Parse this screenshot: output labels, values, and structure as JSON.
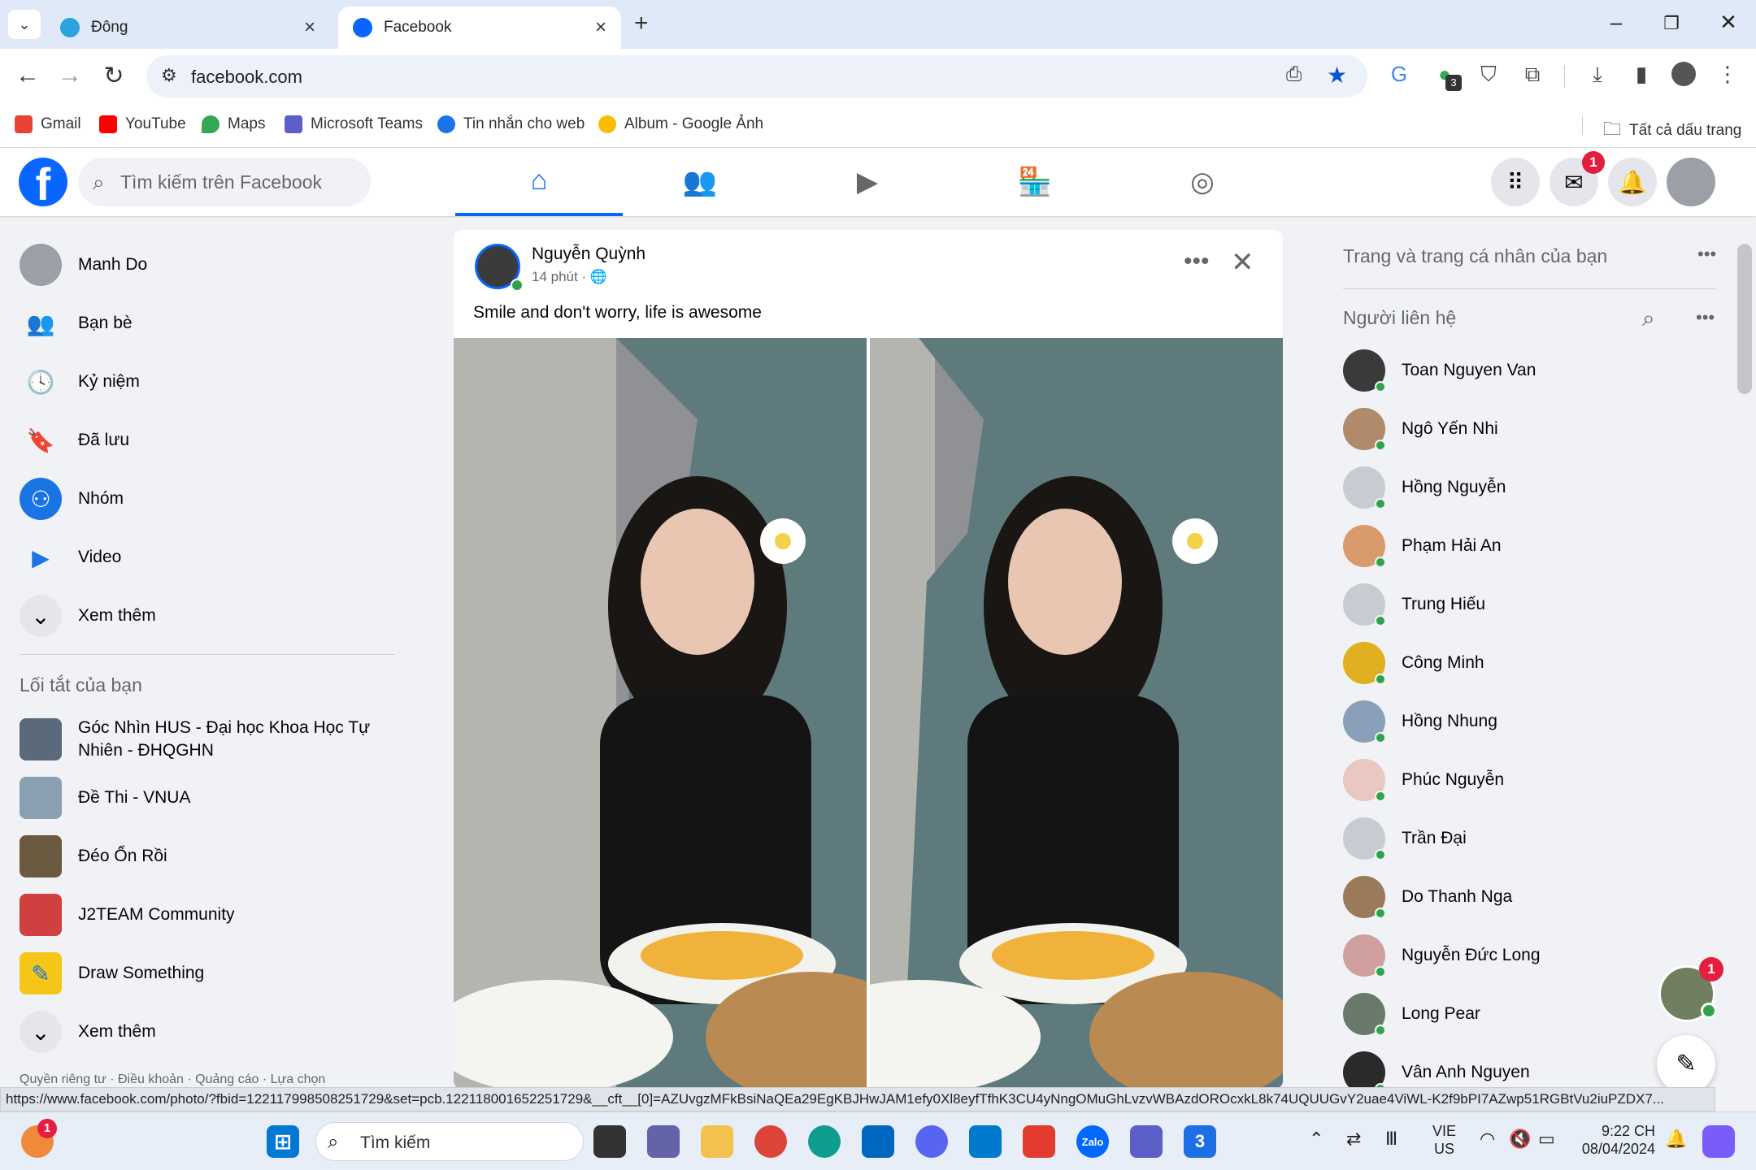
{
  "browser": {
    "tabs": [
      {
        "title": "Đông"
      },
      {
        "title": "Facebook"
      }
    ],
    "url": "facebook.com",
    "bookmarks": [
      {
        "label": "Gmail"
      },
      {
        "label": "YouTube"
      },
      {
        "label": "Maps"
      },
      {
        "label": "Microsoft Teams"
      },
      {
        "label": "Tin nhắn cho web"
      },
      {
        "label": "Album - Google Ảnh"
      }
    ],
    "all_bookmarks": "Tất cả dấu trang",
    "extension_badge": "3",
    "status_url": "https://www.facebook.com/photo/?fbid=122117998508251729&set=pcb.122118001652251729&__cft__[0]=AZUvgzMFkBsiNaQEa29EgKBJHwJAM1efy0Xl8eyfTfhK3CU4yNngOMuGhLvzvWBAzdOROcxkL8k74UQUUGvY2uae4ViWL-K2f9bPI7AZwp51RGBtVu2iuPZDX7..."
  },
  "facebook": {
    "search_placeholder": "Tìm kiếm trên Facebook",
    "messenger_badge": "1",
    "left_nav": [
      {
        "label": "Manh Do"
      },
      {
        "label": "Bạn bè"
      },
      {
        "label": "Kỷ niệm"
      },
      {
        "label": "Đã lưu"
      },
      {
        "label": "Nhóm"
      },
      {
        "label": "Video"
      },
      {
        "label": "Xem thêm"
      }
    ],
    "shortcuts_title": "Lối tắt của bạn",
    "shortcuts": [
      {
        "label": "Góc Nhìn HUS - Đại học Khoa Học Tự Nhiên - ĐHQGHN"
      },
      {
        "label": "Đề Thi - VNUA"
      },
      {
        "label": "Đéo Ổn Rồi"
      },
      {
        "label": "J2TEAM Community"
      },
      {
        "label": "Draw Something"
      },
      {
        "label": "Xem thêm"
      }
    ],
    "footer": "Quyền riêng tư · Điều khoản · Quảng cáo · Lựa chọn",
    "post": {
      "author": "Nguyễn Quỳnh",
      "time": "14 phút ·",
      "text": "Smile and don't worry, life is awesome"
    },
    "right": {
      "pages_title": "Trang và trang cá nhân của bạn",
      "contacts_title": "Người liên hệ",
      "contacts": [
        {
          "name": "Toan Nguyen Van",
          "color": "#3a3a3a"
        },
        {
          "name": "Ngô Yến Nhi",
          "color": "#b08a6a"
        },
        {
          "name": "Hồng Nguyễn",
          "color": "#c8ccd2"
        },
        {
          "name": "Phạm Hải An",
          "color": "#d99a6c"
        },
        {
          "name": "Trung Hiếu",
          "color": "#c8ccd2"
        },
        {
          "name": "Công Minh",
          "color": "#e0b020"
        },
        {
          "name": "Hồng Nhung",
          "color": "#8aa0b8"
        },
        {
          "name": "Phúc Nguyễn",
          "color": "#e8c8c0"
        },
        {
          "name": "Trần Đại",
          "color": "#c8ccd2"
        },
        {
          "name": "Do Thanh Nga",
          "color": "#9a7a5a"
        },
        {
          "name": "Nguyễn Đức Long",
          "color": "#d0a0a0"
        },
        {
          "name": "Long Pear",
          "color": "#6a7a6a"
        },
        {
          "name": "Vân Anh Nguyen",
          "color": "#2a2a2a"
        }
      ],
      "chat_badge": "1"
    }
  },
  "taskbar": {
    "search_label": "Tìm kiếm",
    "lang_top": "VIE",
    "lang_bottom": "US",
    "time": "9:22 CH",
    "date": "08/04/2024",
    "notif_badge": "1"
  },
  "colors": {
    "fb_blue": "#0866ff",
    "online_green": "#31a24c",
    "badge_red": "#e41e3f"
  }
}
